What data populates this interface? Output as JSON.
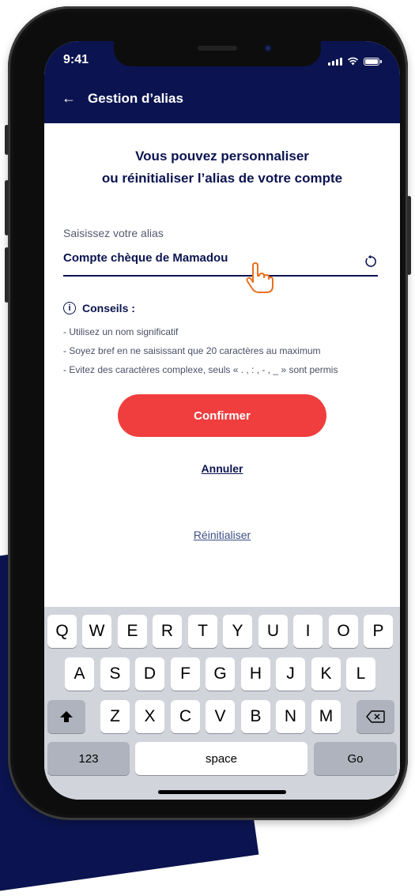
{
  "status_bar": {
    "time": "9:41"
  },
  "header": {
    "back_icon": "arrow-left-icon",
    "title": "Gestion d’alias"
  },
  "heading": {
    "line1": "Vous pouvez personnaliser",
    "line2": "ou réinitialiser l’alias de votre compte"
  },
  "alias_field": {
    "label": "Saisissez votre alias",
    "value": "Compte chèque de Mamadou",
    "reset_icon": "refresh-icon"
  },
  "tips": {
    "title": "Conseils :",
    "items": [
      "- Utilisez un nom significatif",
      "- Soyez bref en ne saisissant que 20 caractères au maximum",
      "- Evitez des caractères complexe, seuls « . , : , - , _ » sont permis"
    ]
  },
  "actions": {
    "confirm": "Confirmer",
    "cancel": "Annuler",
    "reset": "Réinitialiser"
  },
  "keyboard": {
    "row1": [
      "Q",
      "W",
      "E",
      "R",
      "T",
      "Y",
      "U",
      "I",
      "O",
      "P"
    ],
    "row2": [
      "A",
      "S",
      "D",
      "F",
      "G",
      "H",
      "J",
      "K",
      "L"
    ],
    "row3": [
      "Z",
      "X",
      "C",
      "V",
      "B",
      "N",
      "M"
    ],
    "numbers": "123",
    "space": "space",
    "go": "Go"
  },
  "colors": {
    "header": "#0b1450",
    "primary_button": "#f03e3e",
    "text": "#0b1450"
  }
}
